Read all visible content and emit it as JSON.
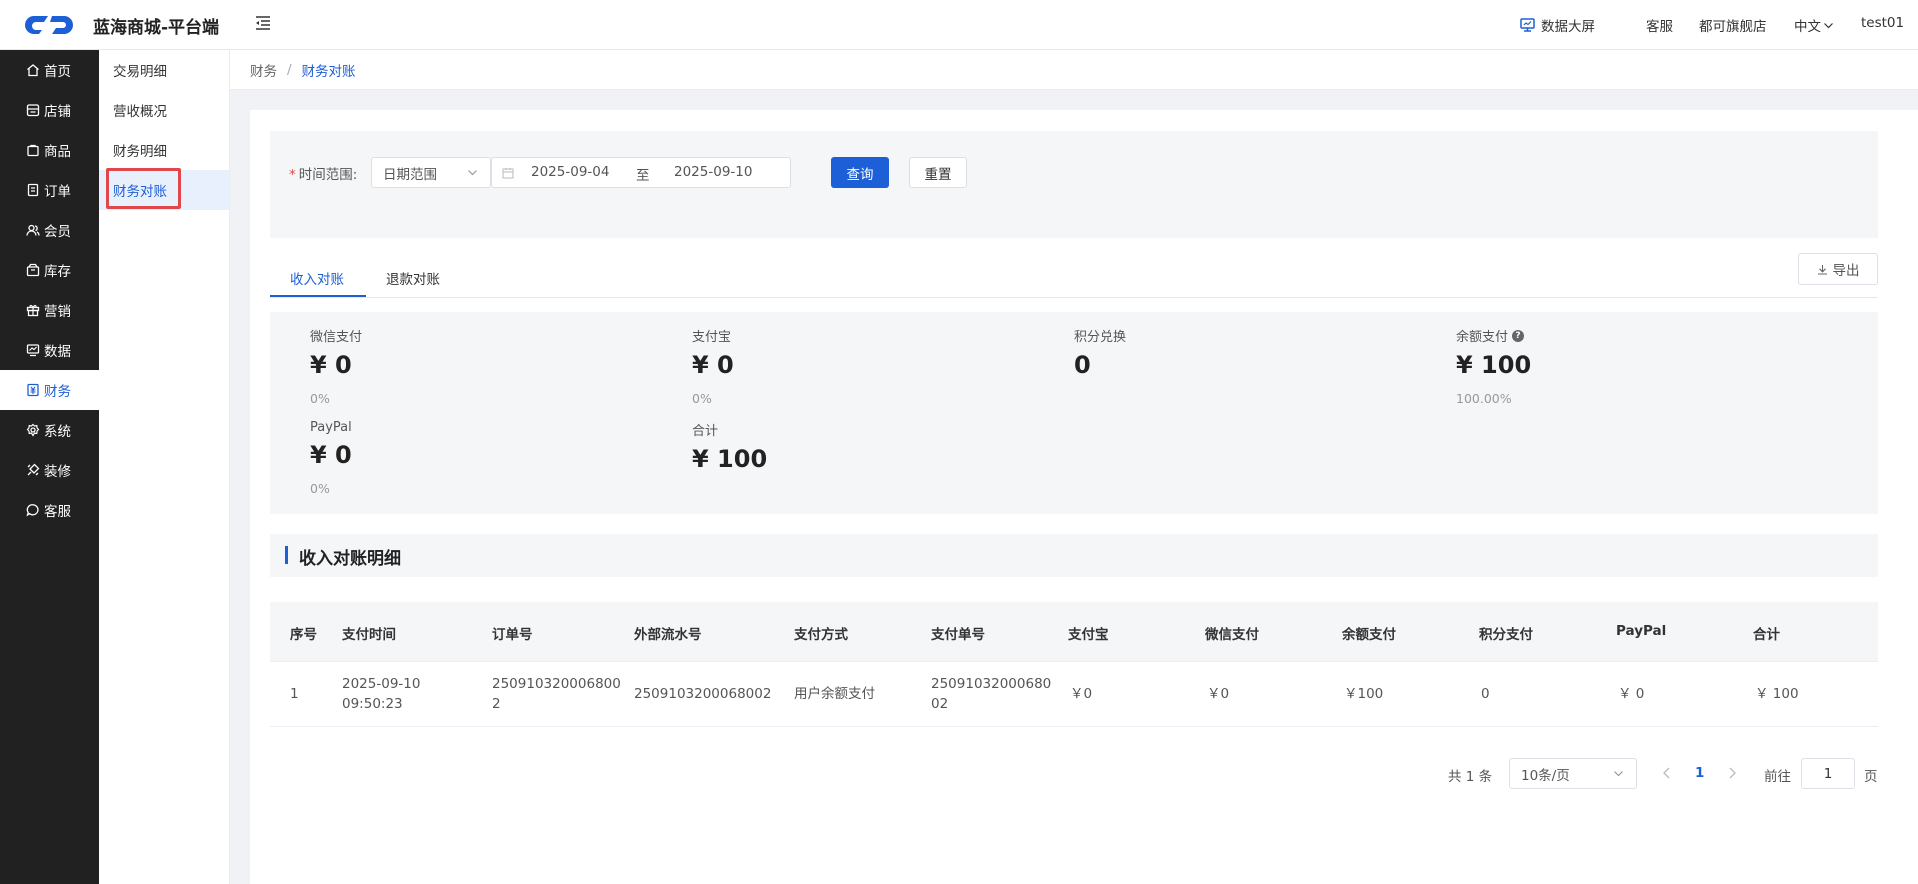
{
  "header": {
    "app_title": "蓝海商城-平台端",
    "data_screen": "数据大屏",
    "service": "客服",
    "store": "都可旗舰店",
    "language": "中文",
    "user": "test01"
  },
  "sidebar": {
    "items": [
      {
        "label": "首页",
        "icon": "home-icon"
      },
      {
        "label": "店铺",
        "icon": "shop-icon"
      },
      {
        "label": "商品",
        "icon": "bag-icon"
      },
      {
        "label": "订单",
        "icon": "order-icon"
      },
      {
        "label": "会员",
        "icon": "member-icon"
      },
      {
        "label": "库存",
        "icon": "inventory-icon"
      },
      {
        "label": "营销",
        "icon": "gift-icon"
      },
      {
        "label": "数据",
        "icon": "chart-icon"
      },
      {
        "label": "财务",
        "icon": "finance-icon",
        "active": true
      },
      {
        "label": "系统",
        "icon": "gear-icon"
      },
      {
        "label": "装修",
        "icon": "brush-icon"
      },
      {
        "label": "客服",
        "icon": "chat-icon"
      }
    ]
  },
  "subnav": {
    "items": [
      {
        "label": "交易明细"
      },
      {
        "label": "营收概况"
      },
      {
        "label": "财务明细"
      },
      {
        "label": "财务对账",
        "active": true
      }
    ]
  },
  "breadcrumb": {
    "parent": "财务",
    "separator": "/",
    "current": "财务对账"
  },
  "filter": {
    "required_mark": "*",
    "label": "时间范围:",
    "range_type": "日期范围",
    "start_date": "2025-09-04",
    "to": "至",
    "end_date": "2025-09-10",
    "query_label": "查询",
    "reset_label": "重置"
  },
  "tabs": {
    "income": "收入对账",
    "refund": "退款对账",
    "export_label": "导出"
  },
  "stats": {
    "wechat": {
      "label": "微信支付",
      "value": "¥ 0",
      "pct": "0%"
    },
    "alipay": {
      "label": "支付宝",
      "value": "¥ 0",
      "pct": "0%"
    },
    "points": {
      "label": "积分兑换",
      "value": "0"
    },
    "balance": {
      "label": "余额支付",
      "value": "¥ 100",
      "pct": "100.00%"
    },
    "paypal": {
      "label": "PayPal",
      "value": "¥ 0",
      "pct": "0%"
    },
    "total": {
      "label": "合计",
      "value": "¥ 100"
    }
  },
  "section_title": "收入对账明细",
  "table": {
    "columns": [
      "序号",
      "支付时间",
      "订单号",
      "外部流水号",
      "支付方式",
      "支付单号",
      "支付宝",
      "微信支付",
      "余额支付",
      "积分支付",
      "PayPal",
      "合计"
    ],
    "rows": [
      {
        "index": "1",
        "pay_time": [
          "2025-09-10",
          "09:50:23"
        ],
        "order_no": [
          "250910320006800",
          "2"
        ],
        "external_no": "2509103200068002",
        "pay_method": "用户余额支付",
        "pay_order_no": [
          "25091032000680",
          "02"
        ],
        "alipay": "￥0",
        "wechat": "￥0",
        "balance": "￥100",
        "points": "0",
        "paypal": "￥ 0",
        "total": "￥ 100"
      }
    ]
  },
  "pagination": {
    "total": "共 1 条",
    "page_size": "10条/页",
    "current_page": "1",
    "goto_label": "前往",
    "goto_value": "1",
    "page_unit": "页"
  },
  "colors": {
    "accent": "#1d5fd6",
    "sidebar_bg": "#212121",
    "highlight": "#e0474a"
  }
}
